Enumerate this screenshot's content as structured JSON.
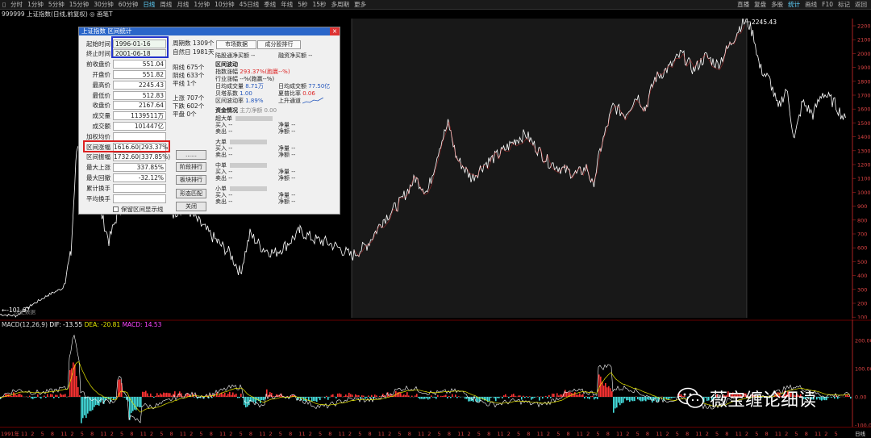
{
  "toolbar": {
    "periods": [
      "分时",
      "1分钟",
      "5分钟",
      "15分钟",
      "30分钟",
      "60分钟",
      "日线",
      "周线",
      "月线",
      "1分钟",
      "10分钟",
      "45日线",
      "季线",
      "年线",
      "5秒",
      "15秒",
      "多周期",
      "更多"
    ],
    "active_period": "日线",
    "right_items": [
      "直播",
      "复盘",
      "多股",
      "统计",
      "画线",
      "F10",
      "标记",
      "返回"
    ]
  },
  "chart_title": "999999 上证指数(日线,前复权) ◎ 画笔T",
  "price_axis": [
    "2200",
    "2100",
    "2000",
    "1900",
    "1800",
    "1700",
    "1600",
    "1500",
    "1400",
    "1300",
    "1200",
    "1100",
    "1000",
    "900",
    "800",
    "700",
    "600",
    "500",
    "400",
    "300",
    "200",
    "100"
  ],
  "max_label": "2245.43",
  "min_label": "←-101.67",
  "min_sublabel": "历史数据",
  "macd": {
    "title": "MACD(12,26,9)",
    "dif": "DIF: -13.55",
    "dea": "DEA: -20.81",
    "macd": "MACD: 14.53",
    "axis": [
      "200.00",
      "100.00",
      "0.00",
      "-100.00"
    ]
  },
  "time_axis": {
    "start": "1991年",
    "labels": [
      "11",
      "2",
      "5",
      "8",
      "11",
      "2",
      "5",
      "8",
      "11",
      "2",
      "5",
      "8",
      "11",
      "2",
      "5",
      "8",
      "11",
      "2",
      "5",
      "8",
      "11",
      "2",
      "5",
      "8",
      "11",
      "2",
      "5",
      "8",
      "11",
      "2",
      "5",
      "8",
      "11",
      "2",
      "5",
      "8",
      "11",
      "2",
      "5",
      "8",
      "11",
      "2",
      "5",
      "8",
      "11",
      "2",
      "5",
      "8",
      "11",
      "2",
      "5",
      "8",
      "11",
      "2",
      "5",
      "8",
      "11",
      "2",
      "5",
      "8",
      "11",
      "2",
      "5",
      "8",
      "11",
      "2",
      "5",
      "8",
      "11",
      "2",
      "5",
      "8",
      "11",
      "2",
      "5",
      "8",
      "11",
      "2",
      "5",
      "8",
      "11",
      "2",
      "5",
      "8"
    ],
    "end": "日线"
  },
  "dialog": {
    "title": "上证指数 区间统计",
    "close": "×",
    "fields": [
      {
        "label": "起始时间",
        "value": "1996-01-16",
        "type": "date"
      },
      {
        "label": "终止时间",
        "value": "2001-06-18",
        "type": "date"
      },
      {
        "label": "前收盘价",
        "value": "551.04"
      },
      {
        "label": "开盘价",
        "value": "551.82"
      },
      {
        "label": "最高价",
        "value": "2245.43"
      },
      {
        "label": "最低价",
        "value": "512.83"
      },
      {
        "label": "收盘价",
        "value": "2167.64"
      },
      {
        "label": "成交量",
        "value": "1139511万"
      },
      {
        "label": "成交额",
        "value": "101447亿"
      },
      {
        "label": "加权均价",
        "value": ""
      },
      {
        "label": "区间涨幅",
        "value": "1616.60(293.37%)"
      },
      {
        "label": "区间振幅",
        "value": "1732.60(337.85%)"
      },
      {
        "label": "最大上涨",
        "value": "337.85%"
      },
      {
        "label": "最大回撤",
        "value": "-32.12%"
      },
      {
        "label": "累计换手",
        "value": ""
      },
      {
        "label": "平均换手",
        "value": ""
      }
    ],
    "checkbox_label": "保留区间显示线",
    "period_count": "周期数 1309个",
    "natural_days": "自然日 1981天",
    "yang": "阳线 675个",
    "yin": "阴线 633个",
    "flat": "平线 1个",
    "up": "上涨 707个",
    "down": "下跌 602个",
    "even": "平盘 0个",
    "buttons": [
      "……",
      "阶段排行",
      "板块排行",
      "形态匹配",
      "关闭"
    ],
    "tabs": [
      "市场数据",
      "成分股排行"
    ],
    "north_buy": "陆股通净买额 --",
    "margin_buy": "融资净买额 --",
    "range_title": "区间波动",
    "index_change_label": "指数涨幅",
    "index_change_val": "293.37%(跑赢--%)",
    "industry_change": "行业涨幅 --%(跑赢--%)",
    "avg_turnover_label": "日均成交量",
    "avg_turnover_val": "8.71万",
    "avg_amount_label": "日均成交额",
    "avg_amount_val": "77.50亿",
    "beta_label": "贝塔系数",
    "beta_val": "1.00",
    "sharpe_label": "夏普比率",
    "sharpe_val": "0.06",
    "volatility_label": "区间波动率",
    "volatility_val": "1.89%",
    "channel_label": "上升通道",
    "capital_title": "资金情况",
    "main_net": "主力净额 0.00",
    "groups": [
      {
        "name": "超大单",
        "buy": "买入 --",
        "sell": "卖出 --",
        "net1": "净量 --",
        "net2": "净额 --"
      },
      {
        "name": "大单",
        "buy": "买入 --",
        "sell": "卖出 --",
        "net1": "净量 --",
        "net2": "净额 --"
      },
      {
        "name": "中单",
        "buy": "买入 --",
        "sell": "卖出 --",
        "net1": "净量 --",
        "net2": "净额 --"
      },
      {
        "name": "小单",
        "buy": "买入 --",
        "sell": "卖出 --",
        "net1": "净量 --",
        "net2": "净额 --"
      }
    ]
  },
  "watermark": "薇宝缠论细读",
  "colors": {
    "up": "#ff3333",
    "down": "#44dddd",
    "line": "#ffffff",
    "dif": "#ffffff",
    "dea": "#e6e600",
    "macd": "#ff44ff",
    "axis": "#cc2222"
  }
}
